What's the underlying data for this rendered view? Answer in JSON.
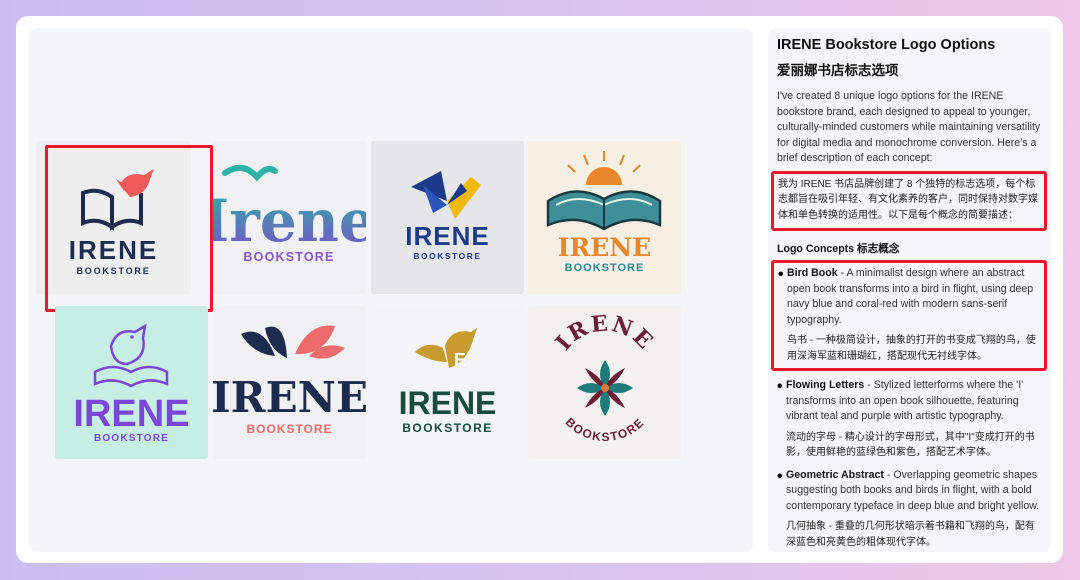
{
  "colors": {
    "accent_red": "#e8192c",
    "navy": "#1d2b4f",
    "coral": "#ee5a5a"
  },
  "gallery": {
    "logos": [
      {
        "id": "bird-book",
        "name": "IRENE",
        "sub": "BOOKSTORE"
      },
      {
        "id": "flowing-letters",
        "name": "Irene",
        "sub": "BOOKSTORE"
      },
      {
        "id": "geometric-abstract",
        "name": "IRENE",
        "sub": "BOOKSTORE"
      },
      {
        "id": "sunrise-book",
        "name": "IRENE",
        "sub": "BOOKSTORE"
      },
      {
        "id": "purple-bird",
        "name": "IRENE",
        "sub": "BOOKSTORE"
      },
      {
        "id": "leaf-letters",
        "name": "IRENE",
        "sub": "BOOKSTORE"
      },
      {
        "id": "golden-bird-e",
        "name": "IRENE",
        "sub": "BOOKSTORE"
      },
      {
        "id": "mandala",
        "name": "IRENE",
        "sub": "BOOKSTORE"
      }
    ]
  },
  "panel": {
    "title": "IRENE Bookstore Logo Options",
    "title_zh": "爱丽娜书店标志选项",
    "intro": "I've created 8 unique logo options for the IRENE bookstore brand, each designed to appeal to younger, culturally-minded customers while maintaining versatility for digital media and monochrome conversion. Here's a brief description of each concept:",
    "intro_zh": "我为 IRENE 书店品牌创建了 8 个独特的标志选项，每个标志都旨在吸引年轻、有文化素养的客户，同时保持对数字媒体和单色转换的适用性。以下是每个概念的简要描述：",
    "concepts_heading": "Logo Concepts  标志概念",
    "concepts": [
      {
        "name": "Bird Book",
        "desc": " - A minimalist design where an abstract open book transforms into a bird in flight, using deep navy blue and coral-red with modern sans-serif typography.",
        "zh": "鸟书 - 一种极简设计，抽象的打开的书变成飞翔的鸟，使用深海军蓝和珊瑚红，搭配现代无衬线字体。"
      },
      {
        "name": "Flowing Letters",
        "desc": " - Stylized letterforms where the 'I' transforms into an open book silhouette, featuring vibrant teal and purple with artistic typography.",
        "zh": "流动的字母 - 精心设计的字母形式，其中\"I\"变成打开的书影，使用鲜艳的蓝绿色和紫色，搭配艺术字体。"
      },
      {
        "name": "Geometric Abstract",
        "desc": " - Overlapping geometric shapes suggesting both books and birds in flight, with a bold contemporary typeface in deep blue and bright yellow.",
        "zh": "几何抽象 - 重叠的几何形状暗示着书籍和飞翔的鸟，配有深蓝色和亮黄色的粗体现代字体。"
      }
    ]
  }
}
